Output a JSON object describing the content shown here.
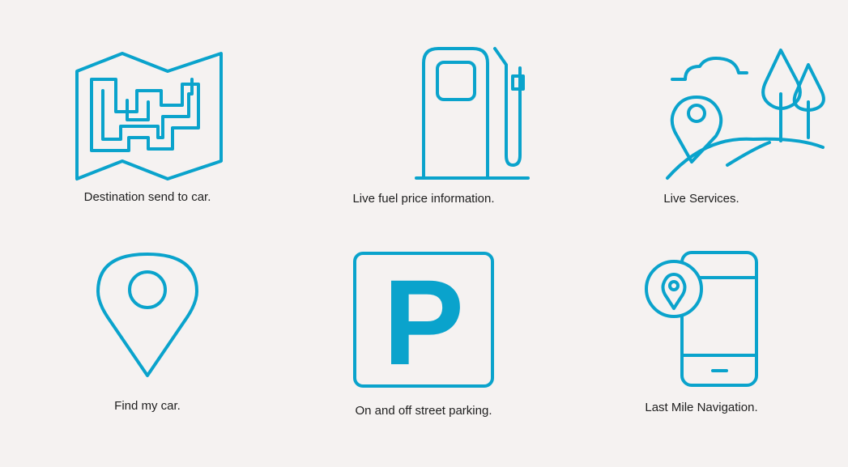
{
  "colors": {
    "accent": "#0aa3cc",
    "background": "#f5f2f1",
    "text": "#1e1e1e"
  },
  "features": [
    {
      "icon": "folded-map-icon",
      "label": "Destination send to car."
    },
    {
      "icon": "fuel-pump-icon",
      "label": "Live fuel price information."
    },
    {
      "icon": "landscape-location-icon",
      "label": "Live Services."
    },
    {
      "icon": "location-pin-icon",
      "label": "Find my car."
    },
    {
      "icon": "parking-sign-icon",
      "label": "On and off street parking.",
      "glyph": "P"
    },
    {
      "icon": "phone-location-icon",
      "label": "Last Mile Navigation."
    }
  ]
}
